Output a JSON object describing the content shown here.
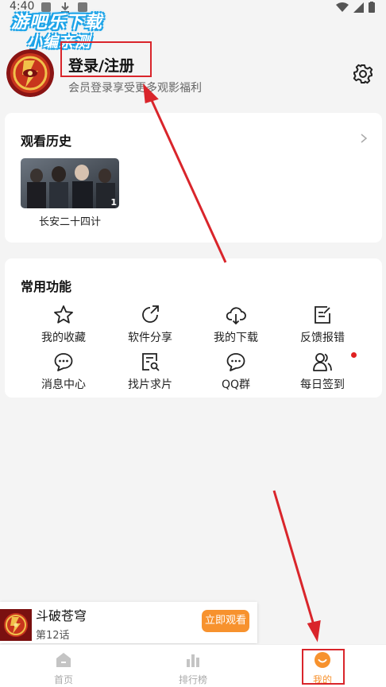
{
  "status_bar": {
    "time": "4:40"
  },
  "watermark": {
    "line1": "游吧乐下载",
    "line2": "小编亲测"
  },
  "header": {
    "login_title": "登录/注册",
    "login_subtitle": "会员登录享受更多观影福利",
    "avatar_icon": "app-logo-icon",
    "settings_icon": "gear-icon"
  },
  "history": {
    "title": "观看历史",
    "items": [
      {
        "title": "长安二十四计",
        "badge": "1"
      }
    ]
  },
  "functions": {
    "title": "常用功能",
    "items": [
      {
        "label": "我的收藏",
        "icon": "star-icon"
      },
      {
        "label": "软件分享",
        "icon": "share-icon"
      },
      {
        "label": "我的下载",
        "icon": "cloud-download-icon"
      },
      {
        "label": "反馈报错",
        "icon": "feedback-icon"
      },
      {
        "label": "消息中心",
        "icon": "chat-icon"
      },
      {
        "label": "找片求片",
        "icon": "search-document-icon"
      },
      {
        "label": "QQ群",
        "icon": "chat-bubbles-icon"
      },
      {
        "label": "每日签到",
        "icon": "users-icon"
      }
    ]
  },
  "mini_player": {
    "title": "斗破苍穹",
    "episode": "第12话",
    "watch_label": "立即观看"
  },
  "nav": {
    "items": [
      {
        "label": "首页",
        "icon": "home-icon"
      },
      {
        "label": "排行榜",
        "icon": "bar-chart-icon"
      },
      {
        "label": "我的",
        "icon": "smile-icon"
      }
    ],
    "active_index": 2
  },
  "colors": {
    "accent": "#f7922e",
    "annotation": "#d9252b",
    "watermark": "#1aa3e8"
  }
}
